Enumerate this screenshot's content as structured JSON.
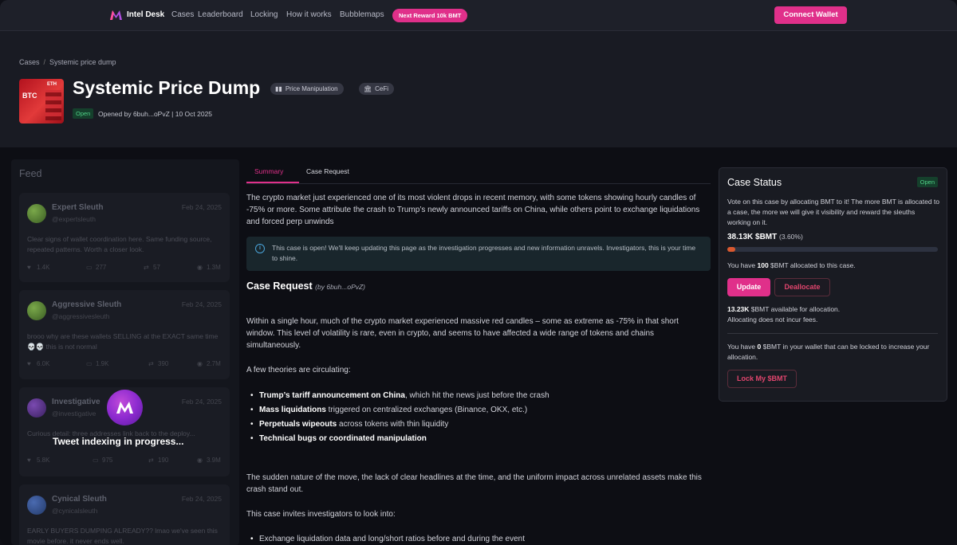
{
  "nav": {
    "brand": "Intel Desk",
    "links": [
      "Cases",
      "Leaderboard",
      "Locking",
      "How it works",
      "Bubblemaps"
    ],
    "reward_pill": "Next Reward 10k BMT",
    "connect": "Connect Wallet"
  },
  "breadcrumb": {
    "root": "Cases",
    "sep": "/",
    "current": "Systemic price dump"
  },
  "case": {
    "thumb_big": "BTC",
    "thumb_small": "ETH",
    "title": "Systemic Price Dump",
    "tags": [
      {
        "label": "Price Manipulation",
        "icon": "candles-icon"
      },
      {
        "label": "CeFi",
        "icon": "bank-icon"
      }
    ],
    "status": "Open",
    "opened": "Opened by 6buh...oPvZ | 10 Oct 2025"
  },
  "feed": {
    "title": "Feed",
    "cards": [
      {
        "name": "Expert Sleuth",
        "handle": "@expertsleuth",
        "date": "Feb 24, 2025",
        "text": "Clear signs of wallet coordination here. Same funding source, repeated patterns. Worth a closer look.",
        "likes": "1.4K",
        "replies": "277",
        "reposts": "57",
        "views": "1.3M"
      },
      {
        "name": "Aggressive Sleuth",
        "handle": "@aggressivesleuth",
        "date": "Feb 24, 2025",
        "text": "brooo why are these wallets SELLING at the EXACT same time 💀💀 this is not normal",
        "likes": "6.0K",
        "replies": "1.9K",
        "reposts": "390",
        "views": "2.7M"
      },
      {
        "name": "Investigative",
        "handle": "@investigative",
        "date": "Feb 24, 2025",
        "text": "Curious detail: three addresses link back to the deploy...",
        "likes": "5.8K",
        "replies": "975",
        "reposts": "190",
        "views": "3.9M"
      },
      {
        "name": "Cynical Sleuth",
        "handle": "@cynicalsleuth",
        "date": "Feb 24, 2025",
        "text": "EARLY BUYERS DUMPING ALREADY?? lmao we've seen this movie before. it never ends well.",
        "likes": "",
        "replies": "",
        "reposts": "",
        "views": ""
      }
    ],
    "overlay": "Tweet indexing in progress..."
  },
  "tabs": [
    "Summary",
    "Case Request"
  ],
  "summary": "The crypto market just experienced one of its most violent drops in recent memory, with some tokens showing hourly candles of -75% or more. Some attribute the crash to Trump’s newly announced tariffs on China, while others point to exchange liquidations and forced perp unwinds",
  "info": "This case is open! We'll keep updating this page as the investigation progresses and new information unravels. Investigators, this is your time to shine.",
  "request": {
    "heading": "Case Request",
    "by": "(by 6buh...oPvZ)",
    "p1": "Within a single hour, much of the crypto market experienced massive red candles – some as extreme as -75% in that short window. This level of volatility is rare, even in crypto, and seems to have affected a wide range of tokens and chains simultaneously.",
    "p2": "A few theories are circulating:",
    "bullets": [
      {
        "bold": "Trump’s tariff announcement on China",
        "rest": ", which hit the news just before the crash"
      },
      {
        "bold": "Mass liquidations",
        "rest": " triggered on centralized exchanges (Binance, OKX, etc.)"
      },
      {
        "bold": "Perpetuals wipeouts",
        "rest": " across tokens with thin liquidity"
      },
      {
        "bold": "Technical bugs or coordinated manipulation",
        "rest": ""
      }
    ],
    "p3": "The sudden nature of the move, the lack of clear headlines at the time, and the uniform impact across unrelated assets make this crash stand out.",
    "p4": "This case invites investigators to look into:",
    "bullets2": [
      {
        "bold": "",
        "rest": "Exchange liquidation data and long/short ratios before and during the event"
      }
    ]
  },
  "status_panel": {
    "title": "Case Status",
    "badge": "Open",
    "desc": "Vote on this case by allocating BMT to it! The more BMT is allocated to a case, the more we will give it visibility and reward the sleuths working on it.",
    "amount": "38.13K $BMT",
    "pct": "(3.60%)",
    "progress": 0.036,
    "you_have_1": "You have ",
    "you_have_amt": "100",
    "you_have_2": " $BMT allocated to this case.",
    "update": "Update",
    "deallocate": "Deallocate",
    "available_amt": "13.23K",
    "available_rest": " $BMT available for allocation.",
    "no_fees": "Allocating does not incur fees.",
    "wallet_1": "You have ",
    "wallet_amt": "0",
    "wallet_2": " $BMT in your wallet that can be locked to increase your allocation.",
    "lock": "Lock My $BMT"
  }
}
